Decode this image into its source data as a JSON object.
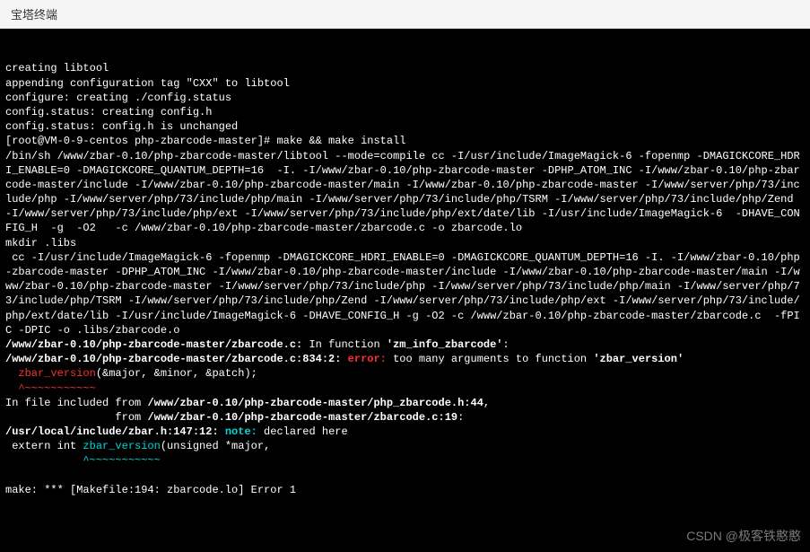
{
  "titlebar": {
    "text": "宝塔终端"
  },
  "lines": {
    "l0": "creating libtool",
    "l1": "appending configuration tag \"CXX\" to libtool",
    "l2": "configure: creating ./config.status",
    "l3": "config.status: creating config.h",
    "l4": "config.status: config.h is unchanged",
    "l5": "[root@VM-0-9-centos php-zbarcode-master]# make && make install",
    "l6": "/bin/sh /www/zbar-0.10/php-zbarcode-master/libtool --mode=compile cc -I/usr/include/ImageMagick-6 -fopenmp -DMAGICKCORE_HDRI_ENABLE=0 -DMAGICKCORE_QUANTUM_DEPTH=16  -I. -I/www/zbar-0.10/php-zbarcode-master -DPHP_ATOM_INC -I/www/zbar-0.10/php-zbarcode-master/include -I/www/zbar-0.10/php-zbarcode-master/main -I/www/zbar-0.10/php-zbarcode-master -I/www/server/php/73/include/php -I/www/server/php/73/include/php/main -I/www/server/php/73/include/php/TSRM -I/www/server/php/73/include/php/Zend -I/www/server/php/73/include/php/ext -I/www/server/php/73/include/php/ext/date/lib -I/usr/include/ImageMagick-6  -DHAVE_CONFIG_H  -g  -O2   -c /www/zbar-0.10/php-zbarcode-master/zbarcode.c -o zbarcode.lo",
    "l7": "mkdir .libs",
    "l8": " cc -I/usr/include/ImageMagick-6 -fopenmp -DMAGICKCORE_HDRI_ENABLE=0 -DMAGICKCORE_QUANTUM_DEPTH=16 -I. -I/www/zbar-0.10/php-zbarcode-master -DPHP_ATOM_INC -I/www/zbar-0.10/php-zbarcode-master/include -I/www/zbar-0.10/php-zbarcode-master/main -I/www/zbar-0.10/php-zbarcode-master -I/www/server/php/73/include/php -I/www/server/php/73/include/php/main -I/www/server/php/73/include/php/TSRM -I/www/server/php/73/include/php/Zend -I/www/server/php/73/include/php/ext -I/www/server/php/73/include/php/ext/date/lib -I/usr/include/ImageMagick-6 -DHAVE_CONFIG_H -g -O2 -c /www/zbar-0.10/php-zbarcode-master/zbarcode.c  -fPIC -DPIC -o .libs/zbarcode.o",
    "err_file": "/www/zbar-0.10/php-zbarcode-master/zbarcode.c:",
    "err_in": " In function ",
    "err_fn": "'zm_info_zbarcode'",
    "err_colon": ":",
    "err_loc": "/www/zbar-0.10/php-zbarcode-master/zbarcode.c:834:2: ",
    "err_word": "error:",
    "err_msg": " too many arguments to function ",
    "err_sym": "'zbar_version'",
    "call": "  zbar_version",
    "call_args": "(&major, &minor, &patch);",
    "caret1": "  ^~~~~~~~~~~~",
    "inc1a": "In file included from ",
    "inc1b": "/www/zbar-0.10/php-zbarcode-master/php_zbarcode.h:44",
    "inc1c": ",",
    "inc2a": "                 from ",
    "inc2b": "/www/zbar-0.10/php-zbarcode-master/zbarcode.c:19",
    "inc2c": ":",
    "note_loc": "/usr/local/include/zbar.h:147:12: ",
    "note_word": "note:",
    "note_msg": " declared here",
    "decl_a": " extern int ",
    "decl_b": "zbar_version",
    "decl_c": "(unsigned *major,",
    "caret2": "            ^~~~~~~~~~~~",
    "make_err": "make: *** [Makefile:194: zbarcode.lo] Error 1",
    "blank": ""
  },
  "watermark": "CSDN @极客铁憨憨"
}
